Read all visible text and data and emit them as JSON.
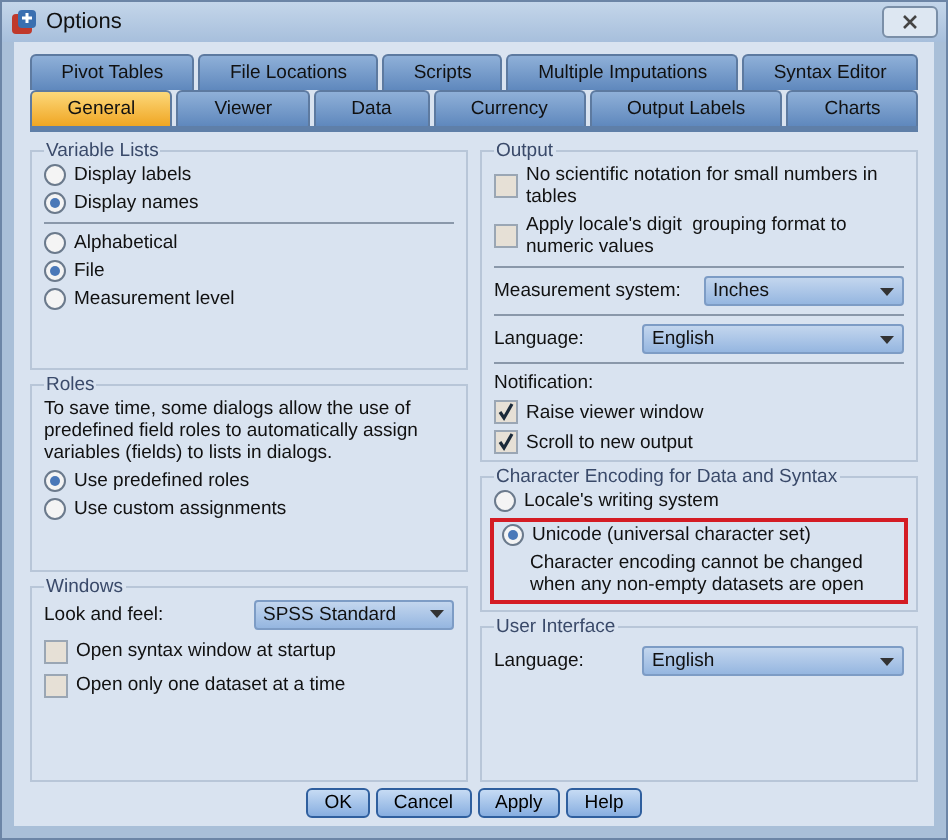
{
  "window": {
    "title": "Options"
  },
  "tab_rows": [
    [
      {
        "label": "Pivot Tables",
        "selected": false
      },
      {
        "label": "File Locations",
        "selected": false
      },
      {
        "label": "Scripts",
        "selected": false
      },
      {
        "label": "Multiple Imputations",
        "selected": false
      },
      {
        "label": "Syntax Editor",
        "selected": false
      }
    ],
    [
      {
        "label": "General",
        "selected": true
      },
      {
        "label": "Viewer",
        "selected": false
      },
      {
        "label": "Data",
        "selected": false
      },
      {
        "label": "Currency",
        "selected": false
      },
      {
        "label": "Output Labels",
        "selected": false
      },
      {
        "label": "Charts",
        "selected": false
      }
    ]
  ],
  "variable_lists": {
    "title": "Variable Lists",
    "display": [
      {
        "label": "Display labels",
        "selected": false
      },
      {
        "label": "Display names",
        "selected": true
      }
    ],
    "order": [
      {
        "label": "Alphabetical",
        "selected": false
      },
      {
        "label": "File",
        "selected": true
      },
      {
        "label": "Measurement level",
        "selected": false
      }
    ]
  },
  "roles": {
    "title": "Roles",
    "description": "To save time, some dialogs allow the use of predefined field roles to automatically assign variables (fields) to lists in dialogs.",
    "options": [
      {
        "label": "Use predefined roles",
        "selected": true
      },
      {
        "label": "Use custom assignments",
        "selected": false
      }
    ]
  },
  "windows": {
    "title": "Windows",
    "look_label": "Look and feel:",
    "look_value": "SPSS Standard",
    "checks": [
      {
        "label": "Open syntax window at startup",
        "checked": false
      },
      {
        "label": "Open only one dataset at a time",
        "checked": false
      }
    ]
  },
  "output": {
    "title": "Output",
    "checks": [
      {
        "label": "No scientific notation for small numbers in tables",
        "checked": false
      },
      {
        "label": "Apply locale's digit  grouping format to numeric values",
        "checked": false
      }
    ],
    "measurement_label": "Measurement system:",
    "measurement_value": "Inches",
    "language_label": "Language:",
    "language_value": "English",
    "notification_label": "Notification:",
    "notifications": [
      {
        "label": "Raise viewer window",
        "checked": true
      },
      {
        "label": "Scroll to new output",
        "checked": true
      }
    ]
  },
  "encoding": {
    "title": "Character Encoding for Data and Syntax",
    "options": [
      {
        "label": "Locale's writing system",
        "selected": false,
        "highlighted": false
      },
      {
        "label": "Unicode (universal character set)",
        "selected": true,
        "highlighted": true
      }
    ],
    "note": "Character encoding cannot be changed when any non-empty datasets are open"
  },
  "user_interface": {
    "title": "User Interface",
    "language_label": "Language:",
    "language_value": "English"
  },
  "buttons": [
    "OK",
    "Cancel",
    "Apply",
    "Help"
  ]
}
